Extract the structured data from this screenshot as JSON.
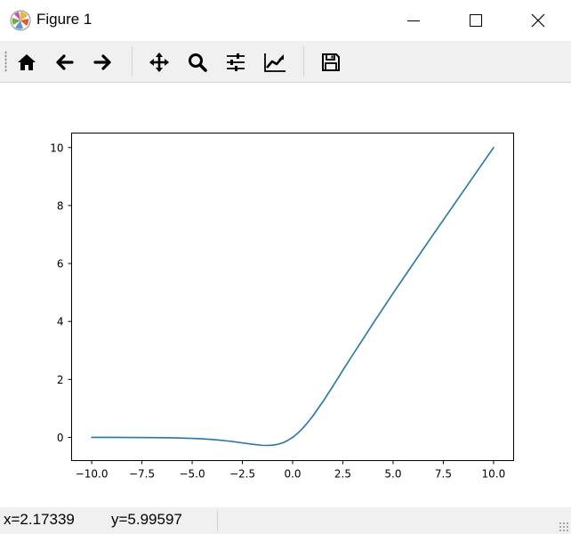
{
  "window": {
    "title": "Figure 1"
  },
  "toolbar": {
    "buttons": [
      {
        "name": "home",
        "icon": "home-icon"
      },
      {
        "name": "back",
        "icon": "arrow-left-icon"
      },
      {
        "name": "forward",
        "icon": "arrow-right-icon"
      },
      {
        "name": "pan",
        "icon": "move-icon"
      },
      {
        "name": "zoom",
        "icon": "magnifier-icon"
      },
      {
        "name": "configure-subplots",
        "icon": "sliders-icon"
      },
      {
        "name": "edit-axis",
        "icon": "line-chart-icon"
      },
      {
        "name": "save",
        "icon": "floppy-disk-icon"
      }
    ]
  },
  "status": {
    "x_readout": "x=2.17339",
    "y_readout": "y=5.99597"
  },
  "colors": {
    "line": "#1f77b4",
    "toolbar_bg": "#f0f0f0"
  },
  "chart_data": {
    "type": "line",
    "title": "",
    "xlabel": "",
    "ylabel": "",
    "xlim": [
      -11,
      11
    ],
    "ylim": [
      -0.8,
      10.5
    ],
    "xticks": [
      -10.0,
      -7.5,
      -5.0,
      -2.5,
      0.0,
      2.5,
      5.0,
      7.5,
      10.0
    ],
    "xtick_labels": [
      "−10.0",
      "−7.5",
      "−5.0",
      "−2.5",
      "0.0",
      "2.5",
      "5.0",
      "7.5",
      "10.0"
    ],
    "yticks": [
      0,
      2,
      4,
      6,
      8,
      10
    ],
    "ytick_labels": [
      "0",
      "2",
      "4",
      "6",
      "8",
      "10"
    ],
    "grid": false,
    "series": [
      {
        "x": [
          -10,
          -9,
          -8,
          -7,
          -6,
          -5,
          -4.5,
          -4,
          -3.5,
          -3,
          -2.5,
          -2,
          -1.5,
          -1.25,
          -1,
          -0.75,
          -0.5,
          -0.25,
          0,
          0.25,
          0.5,
          0.75,
          1,
          1.5,
          2,
          2.5,
          3,
          3.5,
          4,
          5,
          6,
          7,
          8,
          9,
          10
        ],
        "y": [
          0.0,
          -0.001,
          -0.003,
          -0.006,
          -0.015,
          -0.034,
          -0.05,
          -0.072,
          -0.103,
          -0.142,
          -0.19,
          -0.238,
          -0.274,
          -0.278,
          -0.269,
          -0.239,
          -0.189,
          -0.109,
          0.0,
          0.141,
          0.311,
          0.511,
          0.731,
          1.226,
          1.762,
          2.314,
          2.858,
          3.389,
          3.928,
          4.97,
          5.99,
          7.0,
          8.0,
          9.0,
          10.0
        ]
      }
    ]
  }
}
